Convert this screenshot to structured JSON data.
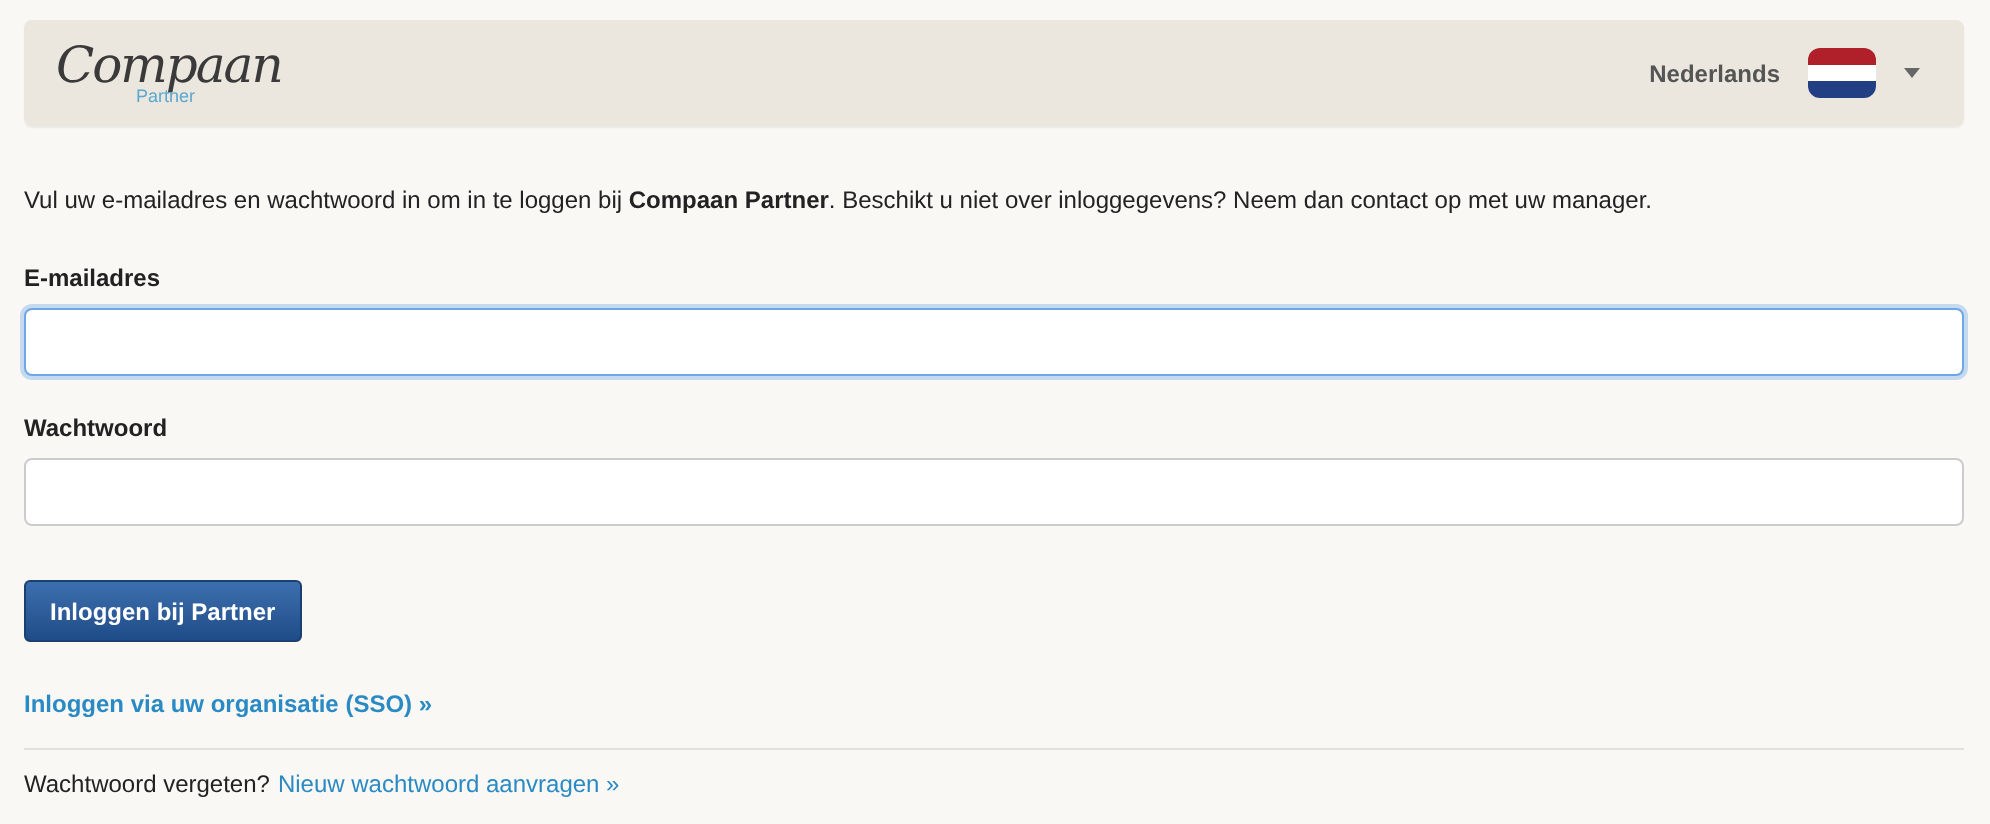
{
  "header": {
    "logo": {
      "name": "Compaan",
      "subtitle": "Partner"
    },
    "language": "Nederlands"
  },
  "intro": "Vul uw e-mailadres en wachtwoord in om in te loggen bij **Compaan Partner**. Beschikt u niet over inloggegevens? Neem dan contact op met uw manager.",
  "fields": [
    {
      "label": "E-mailadres",
      "focused": true
    },
    {
      "label": "Wachtwoord",
      "focused": false
    }
  ],
  "submit_button": "Inloggen bij Partner",
  "sso_link": "Inloggen via uw organisatie (SSO) »",
  "forgot": {
    "text": "Wachtwoord vergeten?",
    "link": "Nieuw wachtwoord aanvragen »"
  }
}
